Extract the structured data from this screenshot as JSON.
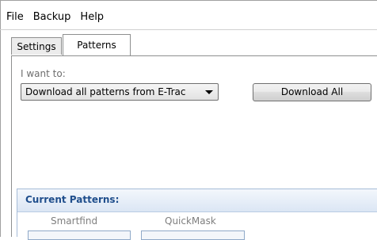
{
  "menu": {
    "items": [
      {
        "label": "File"
      },
      {
        "label": "Backup"
      },
      {
        "label": "Help"
      }
    ]
  },
  "tabs": [
    {
      "label": "Settings",
      "selected": false
    },
    {
      "label": "Patterns",
      "selected": true
    }
  ],
  "panel": {
    "prompt_label": "I want to:",
    "action_select": {
      "value": "Download all patterns from E-Trac"
    },
    "download_button": {
      "label": "Download All"
    }
  },
  "current_patterns": {
    "title": "Current Patterns:",
    "columns": [
      {
        "label": "Smartfind"
      },
      {
        "label": "QuickMask"
      }
    ]
  },
  "colors": {
    "group_title": "#1f4e8c",
    "group_border": "#a6bcd8"
  }
}
